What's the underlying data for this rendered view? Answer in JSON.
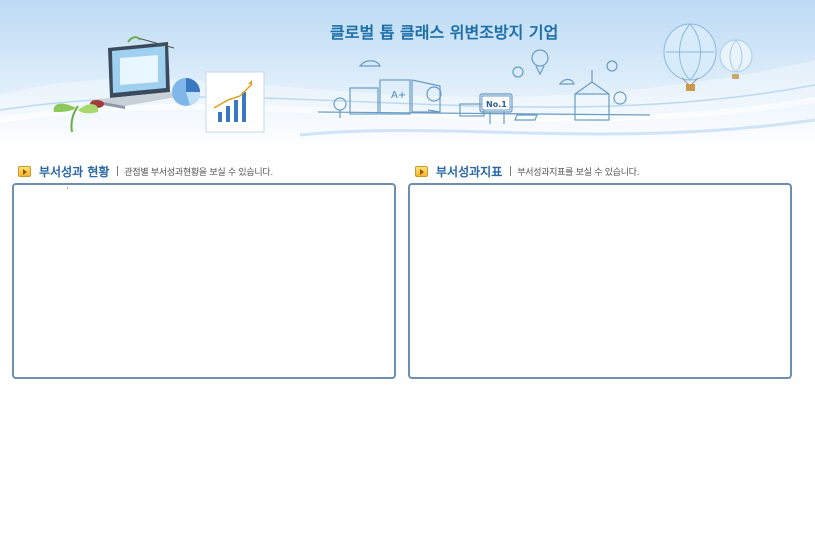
{
  "banner": {
    "slogan": "클로벌 톱 클래스 위변조방지 기업",
    "badge": "No.1",
    "sign_text": "A+"
  },
  "left_section": {
    "title": "부서성과 현황",
    "description": "관점별 부서성과현황을 보실 수 있습니다."
  },
  "right_section": {
    "title": "부서성과지표",
    "description": "부서성과지표를 보실 수 있습니다."
  },
  "colors": {
    "title_blue": "#2a67a6",
    "panel_border": "#6e8fb0",
    "icon_orange": "#f5b52a"
  }
}
